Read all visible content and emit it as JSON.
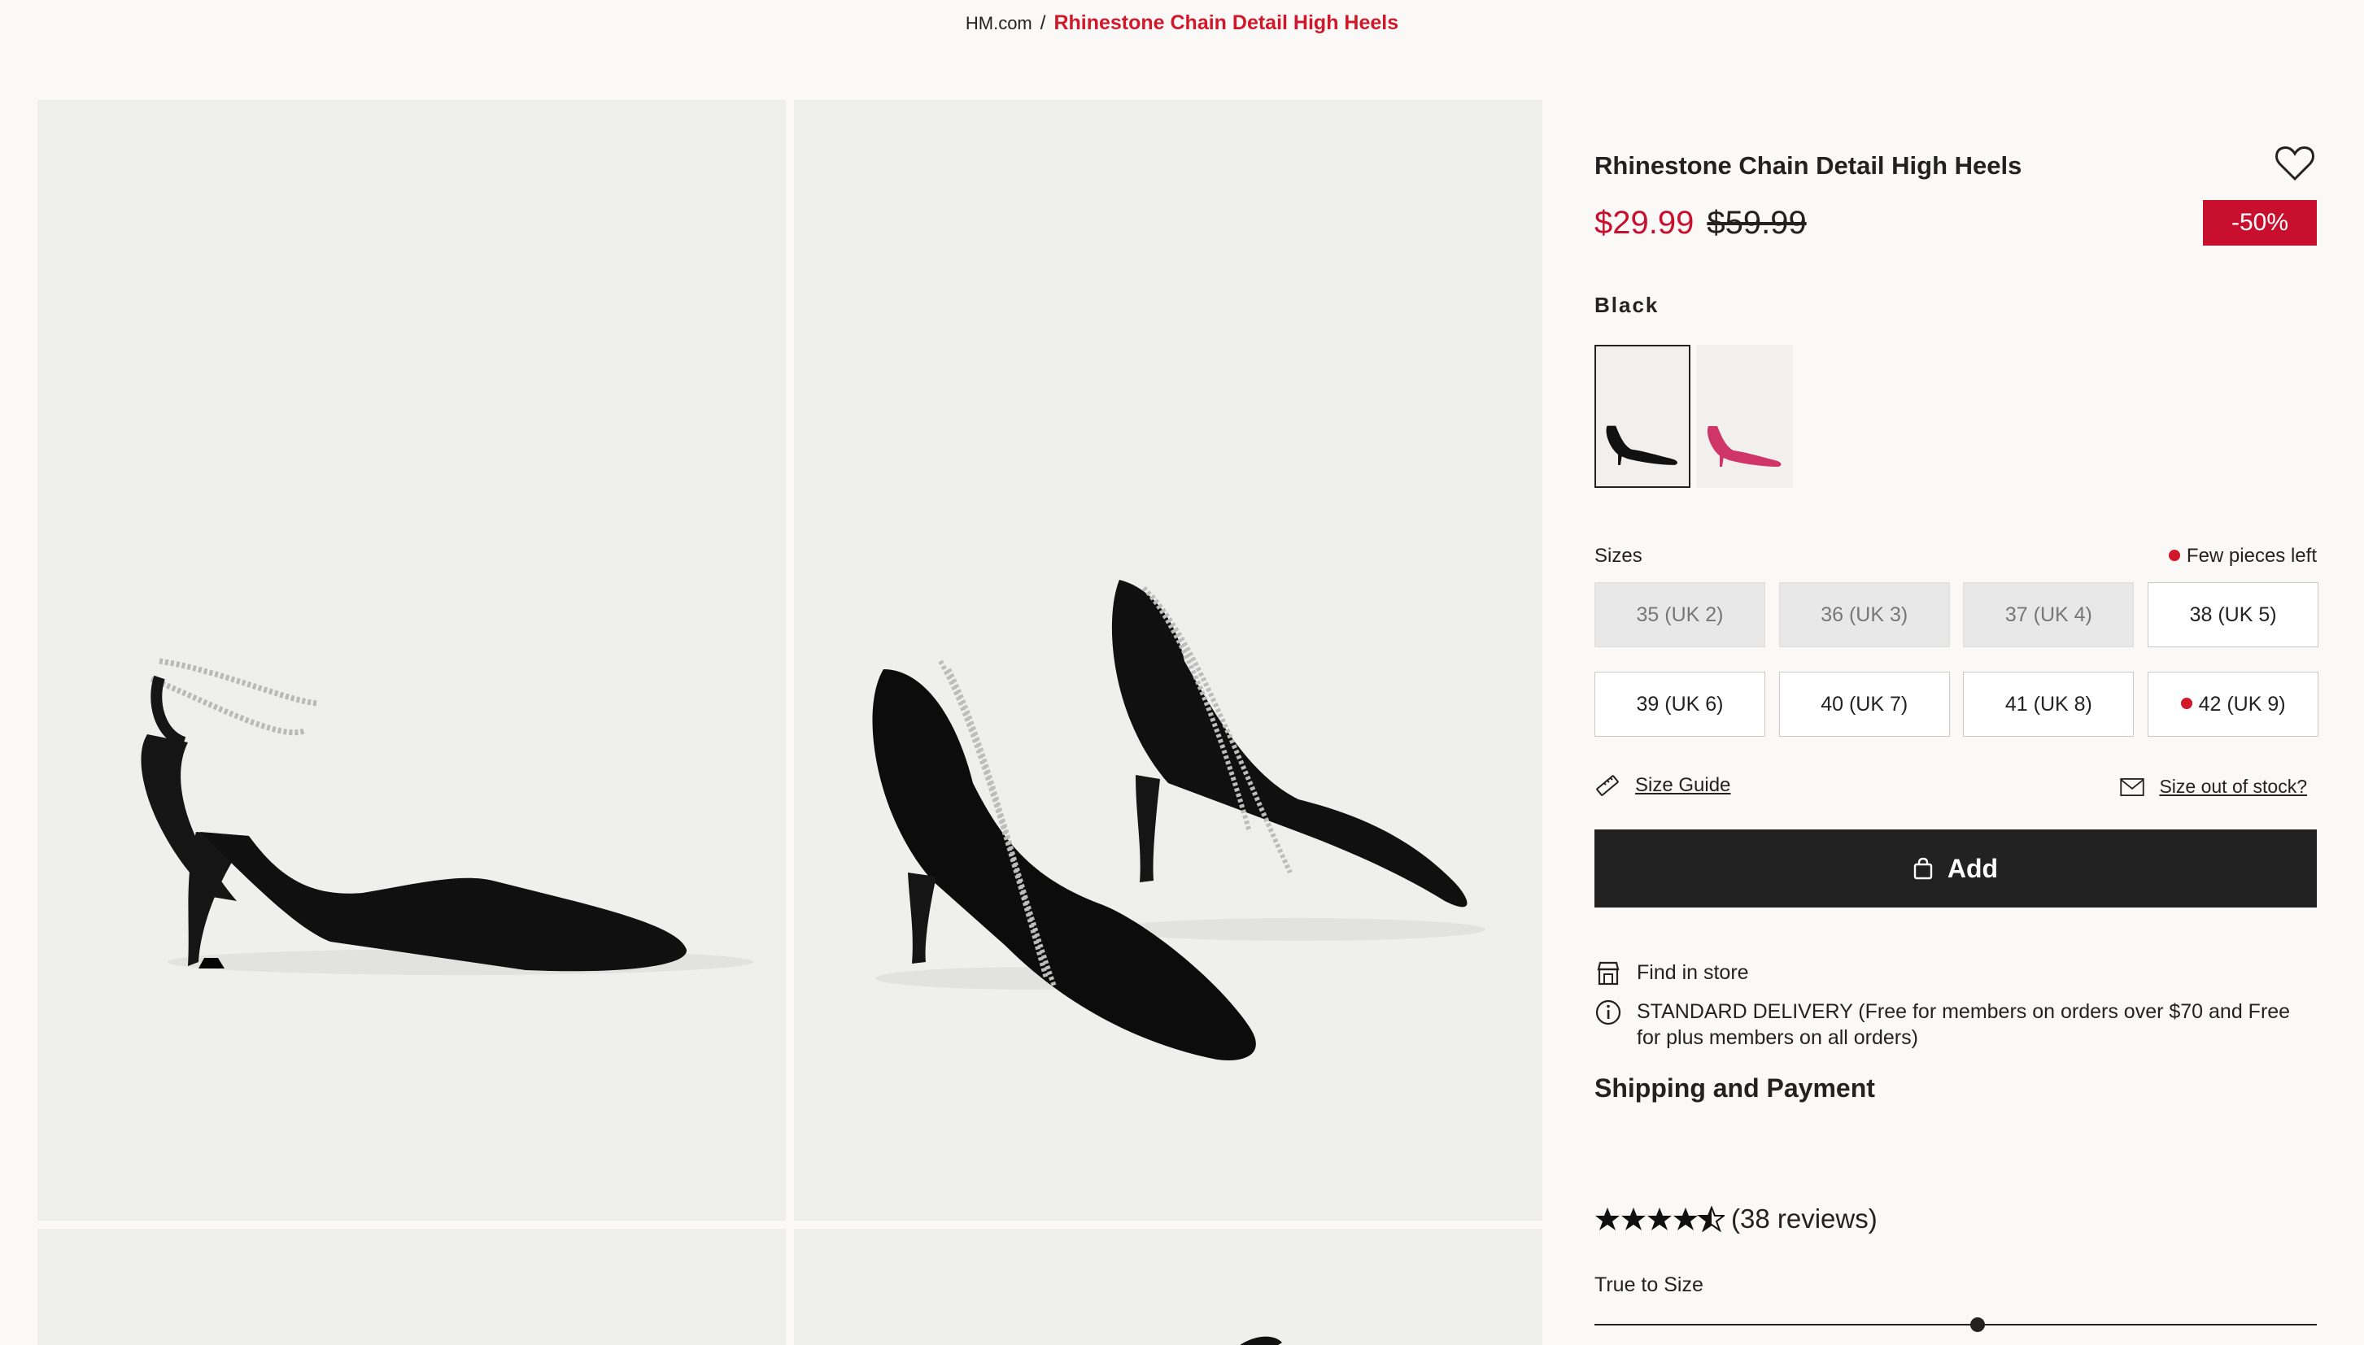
{
  "breadcrumb": {
    "home": "HM.com",
    "separator": "/",
    "current": "Rhinestone Chain Detail High Heels"
  },
  "product": {
    "title": "Rhinestone Chain Detail High Heels",
    "price_sale": "$29.99",
    "price_old": "$59.99",
    "discount": "-50%",
    "color_label": "Black",
    "swatches": [
      {
        "name": "Black",
        "color": "#111111",
        "selected": true
      },
      {
        "name": "Pink",
        "color": "#d0356a",
        "selected": false
      }
    ]
  },
  "sizes": {
    "label": "Sizes",
    "stock_note": "Few pieces left",
    "options": [
      {
        "label": "35 (UK 2)",
        "available": false,
        "low_stock": false
      },
      {
        "label": "36 (UK 3)",
        "available": false,
        "low_stock": false
      },
      {
        "label": "37 (UK 4)",
        "available": false,
        "low_stock": false
      },
      {
        "label": "38 (UK 5)",
        "available": true,
        "low_stock": false
      },
      {
        "label": "39 (UK 6)",
        "available": true,
        "low_stock": false
      },
      {
        "label": "40 (UK 7)",
        "available": true,
        "low_stock": false
      },
      {
        "label": "41 (UK 8)",
        "available": true,
        "low_stock": false
      },
      {
        "label": "42 (UK 9)",
        "available": true,
        "low_stock": true
      }
    ]
  },
  "links": {
    "size_guide": "Size Guide",
    "size_out_of_stock": "Size out of stock?"
  },
  "add_button": "Add",
  "info": {
    "find_in_store": "Find in store",
    "delivery": "STANDARD DELIVERY (Free for members on orders over $70 and Free for plus members on all orders)"
  },
  "shipping_heading": "Shipping and Payment",
  "reviews": {
    "stars": 4.5,
    "count_text": "(38 reviews)"
  },
  "fit": {
    "label": "True to Size",
    "position_fraction": 0.53
  },
  "colors": {
    "accent_red": "#c8102e",
    "dark": "#222222",
    "background": "#faf9f8"
  }
}
